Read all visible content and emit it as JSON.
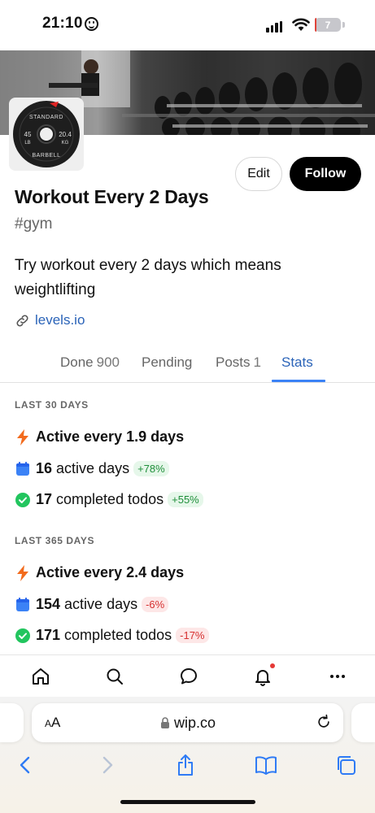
{
  "status_bar": {
    "time": "21:10",
    "battery": "7",
    "battery_level": 0.07
  },
  "cover": {
    "icon": "gym-dumbbell-rack-photo"
  },
  "avatar": {
    "icon": "barbell-plate-icon",
    "text_lines": [
      "STANDARD",
      "45 LB",
      "20.4 KG",
      "BARBELL"
    ]
  },
  "actions": {
    "edit_label": "Edit",
    "follow_label": "Follow"
  },
  "project": {
    "title": "Workout Every 2 Days",
    "hashtag": "#gym",
    "description": "Try workout every 2 days which means weightlifting",
    "link": "levels.io"
  },
  "tabs": [
    {
      "label": "Done",
      "count": "900",
      "active": false
    },
    {
      "label": "Pending",
      "count": "",
      "active": false
    },
    {
      "label": "Posts",
      "count": "1",
      "active": false
    },
    {
      "label": "Stats",
      "count": "",
      "active": true
    }
  ],
  "stats": {
    "last30": {
      "label": "LAST 30 DAYS",
      "active_every": "Active every 1.9 days",
      "active_days_value": "16",
      "active_days_text": "active days",
      "active_days_change": "+78%",
      "completed_value": "17",
      "completed_text": "completed todos",
      "completed_change": "+55%"
    },
    "last365": {
      "label": "LAST 365 DAYS",
      "active_every": "Active every 2.4 days",
      "active_days_value": "154",
      "active_days_text": "active days",
      "active_days_change": "-6%",
      "completed_value": "171",
      "completed_text": "completed todos",
      "completed_change": "-17%"
    }
  },
  "colors": {
    "accent": "#3b82f6",
    "link": "#2a63b8",
    "bolt": "#f26b1d",
    "calendar": "#3b82f6",
    "check": "#22c55e",
    "positive_bg": "#e6f7ea",
    "negative_bg": "#fde7e7"
  },
  "app_nav": [
    "home-icon",
    "search-icon",
    "chat-icon",
    "bell-icon",
    "more-icon"
  ],
  "safari": {
    "aa_label_small": "A",
    "aa_label_big": "A",
    "url": "wip.co"
  }
}
